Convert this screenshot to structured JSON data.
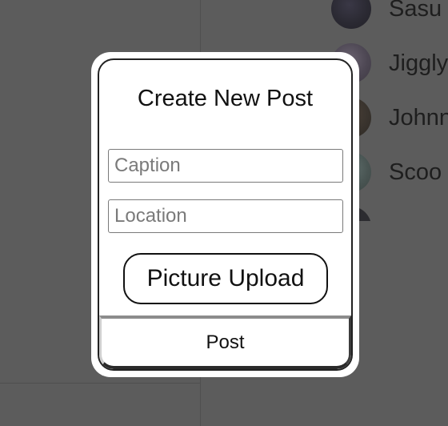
{
  "background": {
    "contacts": [
      {
        "name": "Sasu"
      },
      {
        "name": "Jiggly"
      },
      {
        "name": "Johnn"
      },
      {
        "name": "Scoo"
      },
      {
        "name": ""
      }
    ]
  },
  "modal": {
    "title": "Create New Post",
    "caption_placeholder": "Caption",
    "caption_value": "",
    "location_placeholder": "Location",
    "location_value": "",
    "upload_label": "Picture Upload",
    "post_label": "Post"
  }
}
